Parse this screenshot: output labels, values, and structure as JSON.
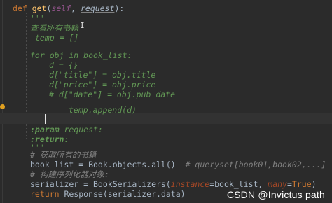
{
  "code": {
    "def_kw": "def",
    "func_name": "get",
    "sig_open": "(",
    "sig_self": "self",
    "sig_sep": ", ",
    "sig_param": "request",
    "sig_close": "):",
    "doc_open": "'''",
    "doc_line1": "查看所有书籍",
    "doc_temp": "temp = []",
    "doc_for": "for obj in book_list:",
    "doc_d": "d = {}",
    "doc_title": "d[\"title\"] = obj.title",
    "doc_price": "d[\"price\"] = obj.price",
    "doc_date": "# d[\"date\"] = obj.pub_date",
    "doc_append": "temp.append(d)",
    "tag_param": ":param",
    "tag_param_rest": " request:",
    "tag_return": ":return",
    "tag_return_rest": ":",
    "doc_close": "'''",
    "cmt_all": "# 获取所有的书籍",
    "q_lhs": "book_list = Book.objects.all()",
    "q_cmt": "# queryset[book01,book02,...]",
    "cmt_ser": "# 构建序列化器对象:",
    "ser_lhs": "serializer = BookSerializers(",
    "ser_instance": "instance",
    "ser_eq1": "=book_list, ",
    "ser_many": "many",
    "ser_eq2": "=",
    "ser_true": "True",
    "ser_close": ")",
    "ret_kw": "return",
    "ret_rest": " Response(serializer.data)"
  },
  "watermark": "CSDN @Invictus path",
  "colors": {
    "background": "#2b2b2b",
    "keyword": "#cc7832",
    "function": "#ffc66d",
    "docstring": "#629755",
    "comment": "#808080",
    "text": "#a9b7c6"
  }
}
